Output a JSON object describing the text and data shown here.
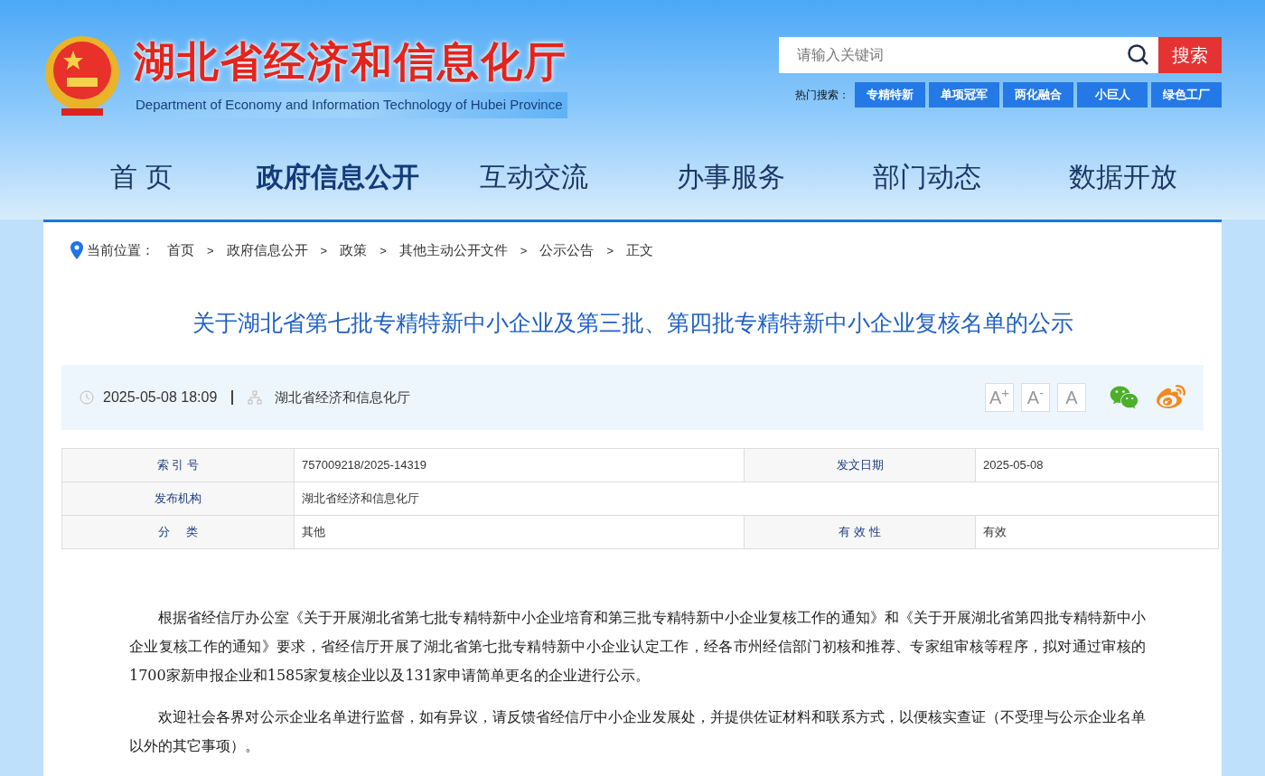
{
  "header": {
    "title": "湖北省经济和信息化厅",
    "subtitle": "Department of Economy and Information Technology of Hubei Province"
  },
  "search": {
    "placeholder": "请输入关键词",
    "button": "搜索",
    "hot_label": "热门搜索：",
    "hot_tags": [
      "专精特新",
      "单项冠军",
      "两化融合",
      "小巨人",
      "绿色工厂"
    ]
  },
  "nav": [
    {
      "label": "首 页",
      "selected": false
    },
    {
      "label": "政府信息公开",
      "selected": true
    },
    {
      "label": "互动交流",
      "selected": false
    },
    {
      "label": "办事服务",
      "selected": false
    },
    {
      "label": "部门动态",
      "selected": false
    },
    {
      "label": "数据开放",
      "selected": false
    }
  ],
  "breadcrumb": {
    "label": "当前位置：",
    "items": [
      "首页",
      "政府信息公开",
      "政策",
      "其他主动公开文件",
      "公示公告",
      "正文"
    ],
    "separator": ">"
  },
  "article": {
    "title": "关于湖北省第七批专精特新中小企业及第三批、第四批专精特新中小企业复核名单的公示",
    "datetime": "2025-05-08 18:09",
    "source": "湖北省经济和信息化厅",
    "font_buttons": [
      "A$^{+}$",
      "A$^{-}$",
      "A"
    ]
  },
  "meta_table": [
    {
      "label": "索 引 号",
      "value": "757009218/2025-14319",
      "label_2": "发文日期",
      "value_2": "2025-05-08"
    },
    {
      "label": "发布机构",
      "value": "湖北省经济和信息化厅"
    },
    {
      "label": "分     类",
      "value": "其他",
      "label_2": "有 效 性",
      "value_2": "有效"
    }
  ],
  "body": [
    "根据省经信厅办公室《关于开展湖北省第七批专精特新中小企业培育和第三批专精特新中小企业复核工作的通知》和《关于开展湖北省第四批专精特新中小企业复核工作的通知》要求，省经信厅开展了湖北省第七批专精特新中小企业认定工作，经各市州经信部门初核和推荐、专家组审核等程序，拟对通过审核的1700家新申报企业和1585家复核企业以及131家申请简单更名的企业进行公示。",
    "欢迎社会各界对公示企业名单进行监督，如有异议，请反馈省经信厅中小企业发展处，并提供佐证材料和联系方式，以便核实查证（不受理与公示企业名单以外的其它事项）。"
  ]
}
